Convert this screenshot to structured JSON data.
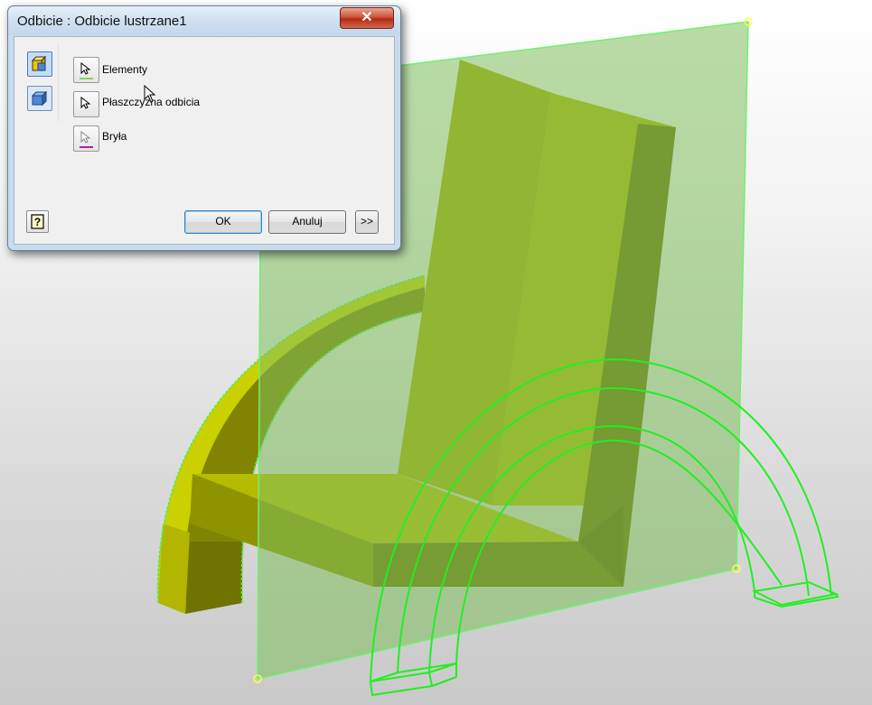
{
  "dialog": {
    "title": "Odbicie : Odbicie lustrzane1",
    "close_label": "✕",
    "tabs": [
      {
        "icon": "mirror-features-icon"
      },
      {
        "icon": "mirror-solid-icon"
      }
    ],
    "selectors": [
      {
        "label": "Elementy",
        "icon": "select-arrow-icon",
        "underline_color": "#7ed957"
      },
      {
        "label": "Płaszczyzna odbicia",
        "icon": "select-arrow-icon",
        "underline_color": ""
      },
      {
        "label": "Bryła",
        "icon": "select-arrow-icon",
        "underline_color": "#b0209a"
      }
    ],
    "help_icon": "help-icon",
    "ok_label": "OK",
    "cancel_label": "Anuluj",
    "more_label": ">>"
  },
  "viewport": {
    "part_color": "#b8bd00",
    "plane_color": "#7fbf5f",
    "preview_color": "#22ee22"
  }
}
